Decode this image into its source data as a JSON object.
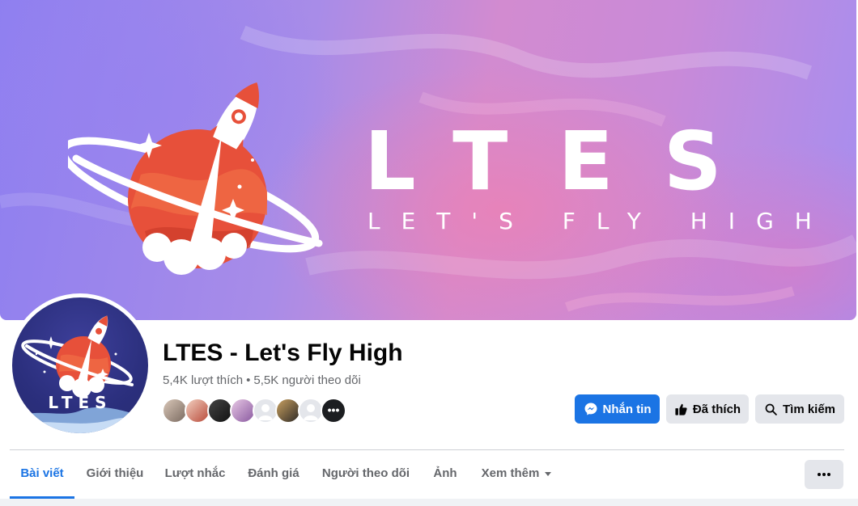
{
  "cover": {
    "headline": "LTES",
    "slogan": "LET'S FLY HIGH"
  },
  "avatar": {
    "text": "LTES"
  },
  "page": {
    "title": "LTES - Let's Fly High",
    "likes": "5,4K lượt thích",
    "separator": "•",
    "followers": "5,5K người theo dõi",
    "friends_more": "•••"
  },
  "actions": {
    "message": "Nhắn tin",
    "liked": "Đã thích",
    "search": "Tìm kiếm"
  },
  "tabs": [
    {
      "label": "Bài viết",
      "active": true
    },
    {
      "label": "Giới thiệu"
    },
    {
      "label": "Lượt nhắc"
    },
    {
      "label": "Đánh giá"
    },
    {
      "label": "Người theo dõi"
    },
    {
      "label": "Ảnh"
    },
    {
      "label": "Xem thêm"
    }
  ],
  "colors": {
    "accent": "#1b74e4",
    "button_gray": "#e4e6eb",
    "text_primary": "#050505",
    "text_secondary": "#65676b"
  },
  "icons": {
    "message": "messenger-icon",
    "liked": "thumbs-up-icon",
    "search": "search-icon",
    "more_tabs": "caret-down-icon",
    "options": "ellipsis-icon"
  }
}
